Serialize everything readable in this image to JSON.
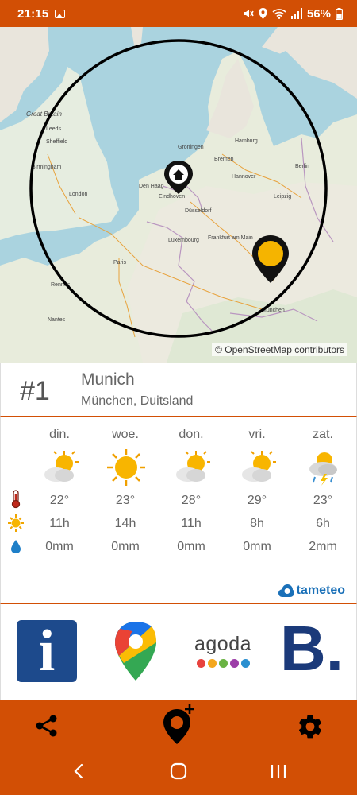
{
  "status_bar": {
    "time": "21:15",
    "battery": "56%",
    "icons": [
      "gallery-icon",
      "mute-icon",
      "location-icon",
      "wifi-icon",
      "signal-icon",
      "battery-icon"
    ]
  },
  "map": {
    "attribution": "© OpenStreetMap contributors",
    "labels": [
      "Great Britain",
      "Leeds",
      "Sheffield",
      "Birmingham",
      "London",
      "Paris",
      "Den Haag",
      "Eindhoven",
      "Düsseldorf",
      "Groningen",
      "Bremen",
      "Hamburg",
      "Hannover",
      "Berlin",
      "Leipzig",
      "Frankfurt am Main",
      "Luxembourg",
      "München",
      "Rennes",
      "Nantes"
    ],
    "markers": [
      "home-marker-icon",
      "location-marker-icon"
    ]
  },
  "location": {
    "rank": "#1",
    "city": "Munich",
    "region": "München, Duitsland"
  },
  "forecast": {
    "days": [
      {
        "name": "din.",
        "icon": "partly-sunny-icon",
        "temp": "22°",
        "sun": "11h",
        "rain": "0mm"
      },
      {
        "name": "woe.",
        "icon": "sunny-icon",
        "temp": "23°",
        "sun": "14h",
        "rain": "0mm"
      },
      {
        "name": "don.",
        "icon": "partly-sunny-icon",
        "temp": "28°",
        "sun": "11h",
        "rain": "0mm"
      },
      {
        "name": "vri.",
        "icon": "partly-sunny-icon",
        "temp": "29°",
        "sun": "8h",
        "rain": "0mm"
      },
      {
        "name": "zat.",
        "icon": "thunderstorm-icon",
        "temp": "23°",
        "sun": "6h",
        "rain": "2mm"
      }
    ],
    "row_icons": [
      "thermometer-icon",
      "sun-hours-icon",
      "rain-drop-icon"
    ],
    "provider": "tameteo"
  },
  "partners": {
    "info_label": "i",
    "agoda_label": "agoda",
    "booking_label": "B.",
    "agoda_dot_colors": [
      "#e8423e",
      "#f4a71d",
      "#6ab344",
      "#9c3ea8",
      "#2a8fd0"
    ]
  },
  "colors": {
    "accent": "#d24f05",
    "info_blue": "#1d4a8c",
    "booking_blue": "#1b3a7a",
    "booking_dot": "#2b8be0",
    "marker_yellow": "#f5b400"
  },
  "bottom_bar": {
    "buttons": [
      "share-icon",
      "add-location-icon",
      "settings-icon"
    ]
  },
  "system_nav": {
    "buttons": [
      "back-icon",
      "home-icon",
      "recents-icon"
    ]
  }
}
